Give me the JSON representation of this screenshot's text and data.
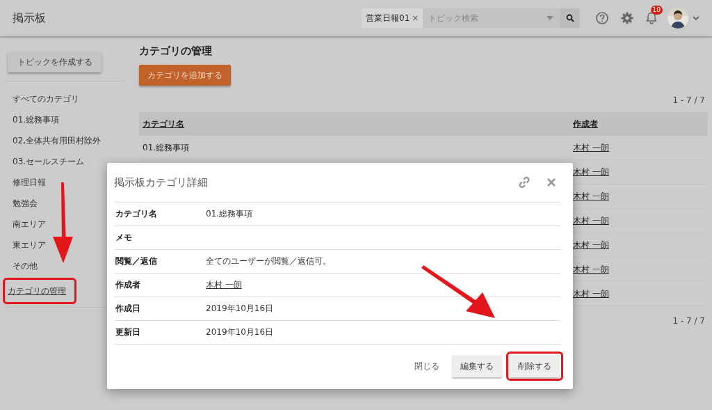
{
  "header": {
    "title": "掲示板",
    "search": {
      "chip": "営業日報01",
      "chip_remove": "×",
      "placeholder": "トピック検索"
    },
    "notification_count": "10"
  },
  "sidebar": {
    "create_button": "トピックを作成する",
    "items": [
      {
        "label": "すべてのカテゴリ"
      },
      {
        "label": "01.総務事項"
      },
      {
        "label": "02,全体共有用田村除外"
      },
      {
        "label": "03.セールスチーム"
      },
      {
        "label": "修理日報"
      },
      {
        "label": "勉強会"
      },
      {
        "label": "南エリア"
      },
      {
        "label": "東エリア"
      },
      {
        "label": "その他"
      }
    ],
    "manage_link": {
      "label": "カテゴリの管理",
      "highlighted": true
    }
  },
  "main": {
    "title": "カテゴリの管理",
    "add_button": "カテゴリを追加する",
    "pagination_top": "1 - 7 / 7",
    "table": {
      "columns": [
        "カテゴリ名",
        "作成者"
      ],
      "rows": [
        {
          "name": "01.総務事項",
          "author": "木村 一朗"
        },
        {
          "author": "木村 一朗"
        },
        {
          "author": "木村 一朗"
        },
        {
          "author": "木村 一朗"
        },
        {
          "author": "木村 一朗"
        },
        {
          "author": "木村 一朗"
        },
        {
          "author": "木村 一朗"
        }
      ]
    },
    "pagination_bottom": "1 - 7 / 7"
  },
  "dialog": {
    "title": "掲示板カテゴリ詳細",
    "fields": [
      {
        "label": "カテゴリ名",
        "value": "01.総務事項",
        "kind": "text"
      },
      {
        "label": "メモ",
        "kind": "text"
      },
      {
        "label": "閲覧／返信",
        "value": "全てのユーザーが閲覧／返信可。",
        "kind": "text"
      },
      {
        "label": "作成者",
        "value": "木村 一朗",
        "kind": "link"
      },
      {
        "label": "作成日",
        "value": "2019年10月16日",
        "kind": "text"
      },
      {
        "label": "更新日",
        "value": "2019年10月16日",
        "kind": "text"
      }
    ],
    "buttons": [
      {
        "label": "閉じる",
        "kind": "flat",
        "highlighted": false
      },
      {
        "label": "編集する",
        "kind": "raised",
        "highlighted": false
      },
      {
        "label": "削除する",
        "kind": "raised",
        "highlighted": true
      }
    ]
  }
}
